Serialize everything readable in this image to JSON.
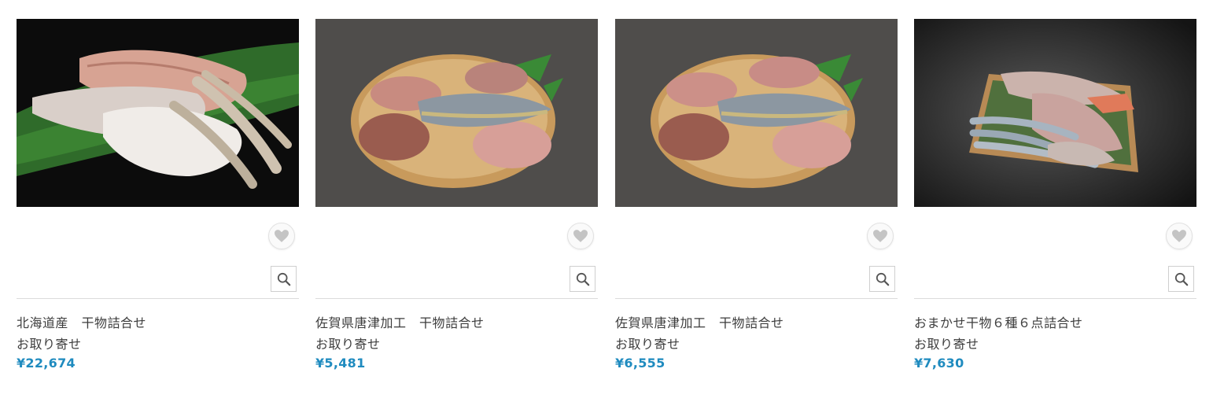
{
  "products": [
    {
      "image_alt": "北海道産 干物詰合せ",
      "name_line1": "北海道産　干物詰合せ",
      "name_line2": "お取り寄せ",
      "price": "¥22,674"
    },
    {
      "image_alt": "佐賀県唐津加工 干物詰合せ",
      "name_line1": "佐賀県唐津加工　干物詰合せ",
      "name_line2": "お取り寄せ",
      "price": "¥5,481"
    },
    {
      "image_alt": "佐賀県唐津加工 干物詰合せ",
      "name_line1": "佐賀県唐津加工　干物詰合せ",
      "name_line2": "お取り寄せ",
      "price": "¥6,555"
    },
    {
      "image_alt": "おまかせ干物６種６点詰合せ",
      "name_line1": "おまかせ干物６種６点詰合せ",
      "name_line2": "お取り寄せ",
      "price": "¥7,630"
    }
  ],
  "icons": {
    "favorite": "heart-icon",
    "zoom": "magnifier-icon"
  },
  "colors": {
    "price": "#1f8bbf",
    "text": "#3c3c3c",
    "heart": "#c4c4c4"
  }
}
